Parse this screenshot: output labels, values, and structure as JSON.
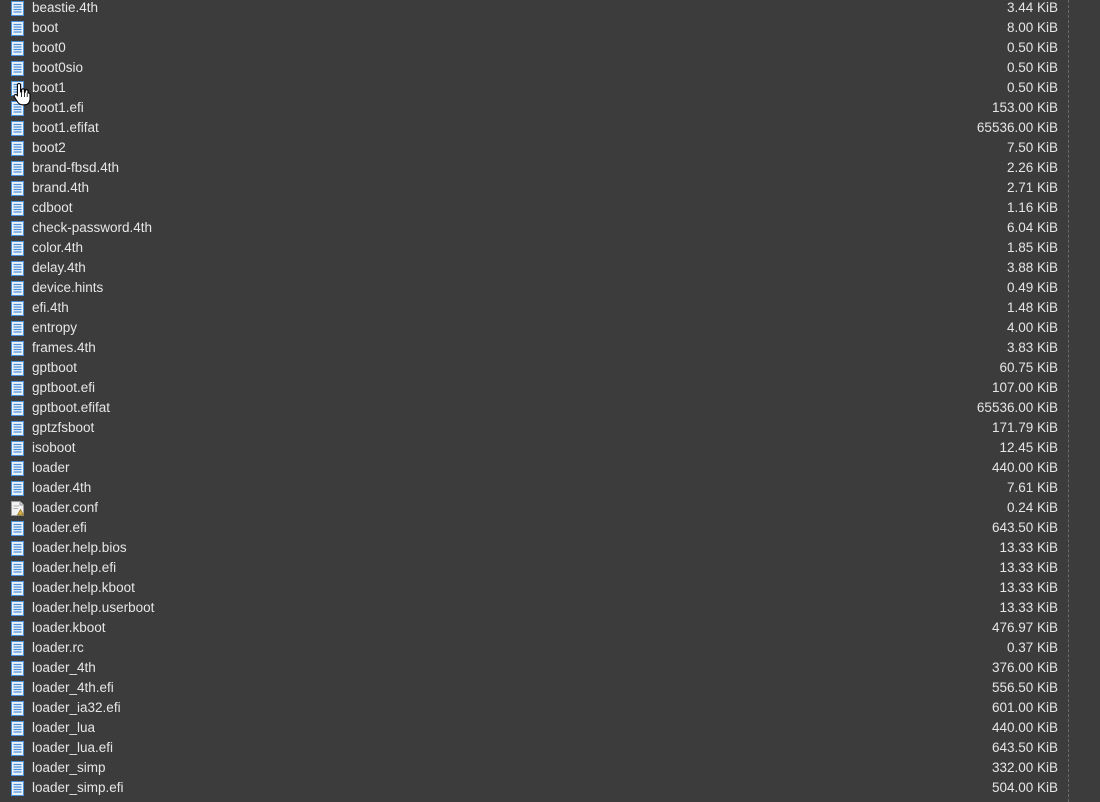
{
  "colors": {
    "background": "#3c3c3c",
    "text": "#e6e6e6",
    "file_icon": "#4a90d9",
    "config_icon": "#d8b04a"
  },
  "files": [
    {
      "name": "beastie.4th",
      "size": "3.44 KiB",
      "icon": "file-icon"
    },
    {
      "name": "boot",
      "size": "8.00 KiB",
      "icon": "file-icon"
    },
    {
      "name": "boot0",
      "size": "0.50 KiB",
      "icon": "file-icon"
    },
    {
      "name": "boot0sio",
      "size": "0.50 KiB",
      "icon": "file-icon"
    },
    {
      "name": "boot1",
      "size": "0.50 KiB",
      "icon": "file-icon"
    },
    {
      "name": "boot1.efi",
      "size": "153.00 KiB",
      "icon": "file-icon"
    },
    {
      "name": "boot1.efifat",
      "size": "65536.00 KiB",
      "icon": "file-icon"
    },
    {
      "name": "boot2",
      "size": "7.50 KiB",
      "icon": "file-icon"
    },
    {
      "name": "brand-fbsd.4th",
      "size": "2.26 KiB",
      "icon": "file-icon"
    },
    {
      "name": "brand.4th",
      "size": "2.71 KiB",
      "icon": "file-icon"
    },
    {
      "name": "cdboot",
      "size": "1.16 KiB",
      "icon": "file-icon"
    },
    {
      "name": "check-password.4th",
      "size": "6.04 KiB",
      "icon": "file-icon"
    },
    {
      "name": "color.4th",
      "size": "1.85 KiB",
      "icon": "file-icon"
    },
    {
      "name": "delay.4th",
      "size": "3.88 KiB",
      "icon": "file-icon"
    },
    {
      "name": "device.hints",
      "size": "0.49 KiB",
      "icon": "file-icon"
    },
    {
      "name": "efi.4th",
      "size": "1.48 KiB",
      "icon": "file-icon"
    },
    {
      "name": "entropy",
      "size": "4.00 KiB",
      "icon": "file-icon"
    },
    {
      "name": "frames.4th",
      "size": "3.83 KiB",
      "icon": "file-icon"
    },
    {
      "name": "gptboot",
      "size": "60.75 KiB",
      "icon": "file-icon"
    },
    {
      "name": "gptboot.efi",
      "size": "107.00 KiB",
      "icon": "file-icon"
    },
    {
      "name": "gptboot.efifat",
      "size": "65536.00 KiB",
      "icon": "file-icon"
    },
    {
      "name": "gptzfsboot",
      "size": "171.79 KiB",
      "icon": "file-icon"
    },
    {
      "name": "isoboot",
      "size": "12.45 KiB",
      "icon": "file-icon"
    },
    {
      "name": "loader",
      "size": "440.00 KiB",
      "icon": "file-icon"
    },
    {
      "name": "loader.4th",
      "size": "7.61 KiB",
      "icon": "file-icon"
    },
    {
      "name": "loader.conf",
      "size": "0.24 KiB",
      "icon": "config-file-icon"
    },
    {
      "name": "loader.efi",
      "size": "643.50 KiB",
      "icon": "file-icon"
    },
    {
      "name": "loader.help.bios",
      "size": "13.33 KiB",
      "icon": "file-icon"
    },
    {
      "name": "loader.help.efi",
      "size": "13.33 KiB",
      "icon": "file-icon"
    },
    {
      "name": "loader.help.kboot",
      "size": "13.33 KiB",
      "icon": "file-icon"
    },
    {
      "name": "loader.help.userboot",
      "size": "13.33 KiB",
      "icon": "file-icon"
    },
    {
      "name": "loader.kboot",
      "size": "476.97 KiB",
      "icon": "file-icon"
    },
    {
      "name": "loader.rc",
      "size": "0.37 KiB",
      "icon": "file-icon"
    },
    {
      "name": "loader_4th",
      "size": "376.00 KiB",
      "icon": "file-icon"
    },
    {
      "name": "loader_4th.efi",
      "size": "556.50 KiB",
      "icon": "file-icon"
    },
    {
      "name": "loader_ia32.efi",
      "size": "601.00 KiB",
      "icon": "file-icon"
    },
    {
      "name": "loader_lua",
      "size": "440.00 KiB",
      "icon": "file-icon"
    },
    {
      "name": "loader_lua.efi",
      "size": "643.50 KiB",
      "icon": "file-icon"
    },
    {
      "name": "loader_simp",
      "size": "332.00 KiB",
      "icon": "file-icon"
    },
    {
      "name": "loader_simp.efi",
      "size": "504.00 KiB",
      "icon": "file-icon"
    }
  ]
}
